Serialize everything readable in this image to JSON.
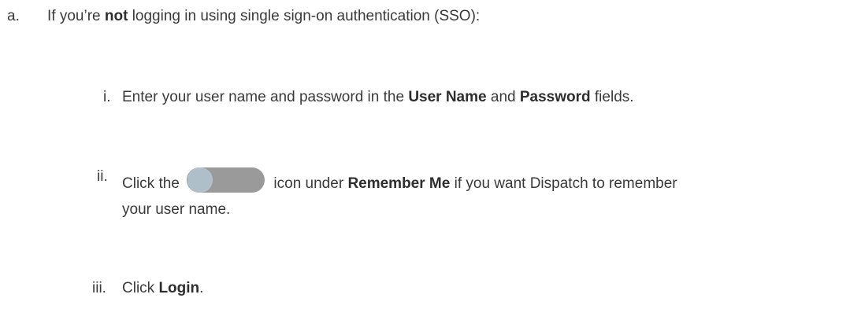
{
  "step_a": {
    "marker": "a.",
    "pre": "If you’re ",
    "bold": "not",
    "post": " logging in using single sign-on authentication (SSO):"
  },
  "step_i": {
    "marker": "i.",
    "t1": "Enter your user name and password in the ",
    "b1": "User Name",
    "t2": " and ",
    "b2": "Password",
    "t3": " fields."
  },
  "step_ii": {
    "marker": "ii.",
    "t1": "Click the ",
    "toggle_icon": "remember-me-toggle-icon",
    "t2": " icon under ",
    "b1": "Remember Me",
    "t3": " if you want Dispatch to remember",
    "t4": "your user name."
  },
  "step_iii": {
    "marker": "iii.",
    "t1": "Click ",
    "b1": "Login",
    "t2": "."
  },
  "colors": {
    "text": "#3a3a3a",
    "toggle_track": "#9a9a9a",
    "toggle_knob": "#aebfca"
  }
}
